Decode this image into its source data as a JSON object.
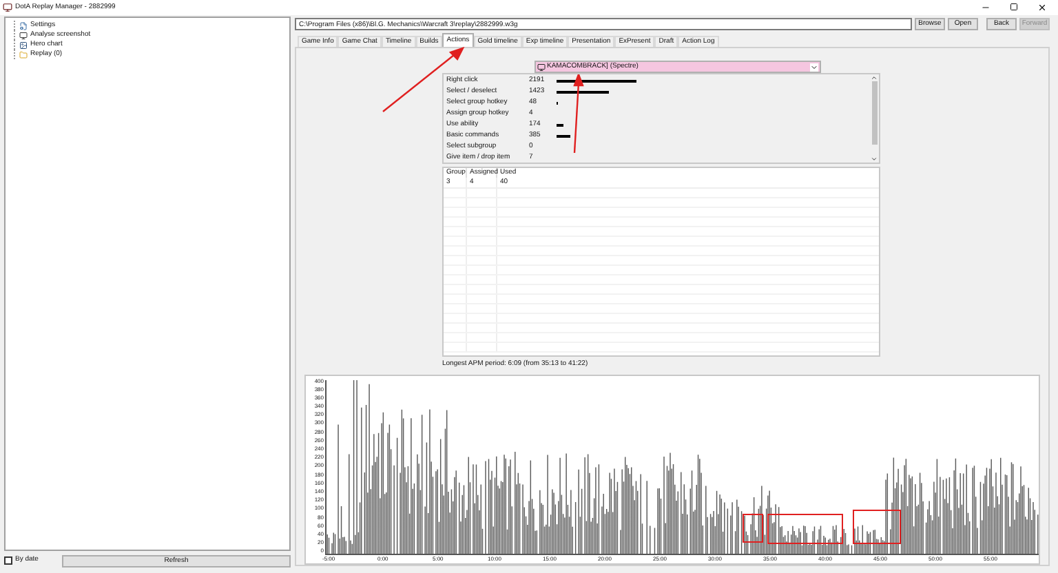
{
  "window": {
    "title": "DotA Replay Manager - 2882999"
  },
  "tree": [
    {
      "label": "Settings"
    },
    {
      "label": "Analyse screenshot"
    },
    {
      "label": "Hero chart"
    },
    {
      "label": "Replay (0)"
    }
  ],
  "by_date": {
    "label": "By date",
    "checked": false
  },
  "refresh_button": "Refresh",
  "path_field": {
    "value": "C:\\Program Files (x86)\\Bl.G. Mechanics\\Warcraft 3\\replay\\2882999.w3g"
  },
  "nav_buttons": [
    {
      "label": "Browse",
      "disabled": false
    },
    {
      "label": "Open",
      "disabled": false
    },
    {
      "label": "Back",
      "disabled": false
    },
    {
      "label": "Forward",
      "disabled": true
    }
  ],
  "tabs": [
    {
      "label": "Game Info",
      "selected": false
    },
    {
      "label": "Game Chat",
      "selected": false
    },
    {
      "label": "Timeline",
      "selected": false
    },
    {
      "label": "Builds",
      "selected": false
    },
    {
      "label": "Actions",
      "selected": true
    },
    {
      "label": "Gold timeline",
      "selected": false
    },
    {
      "label": "Exp timeline",
      "selected": false
    },
    {
      "label": "Presentation",
      "selected": false
    },
    {
      "label": "ExPresent",
      "selected": false
    },
    {
      "label": "Draft",
      "selected": false
    },
    {
      "label": "Action Log",
      "selected": false
    }
  ],
  "player_select": {
    "value": "KAMACOMBRACK] (Spectre)"
  },
  "actions": [
    {
      "name": "Right click",
      "count": "2191"
    },
    {
      "name": "Select / deselect",
      "count": "1423"
    },
    {
      "name": "Select group hotkey",
      "count": "48"
    },
    {
      "name": "Assign group hotkey",
      "count": "4"
    },
    {
      "name": "Use ability",
      "count": "174"
    },
    {
      "name": "Basic commands",
      "count": "385"
    },
    {
      "name": "Select subgroup",
      "count": "0"
    },
    {
      "name": "Give item / drop item",
      "count": "7"
    }
  ],
  "groups_table": {
    "columns": [
      "Group",
      "Assigned",
      "Used"
    ],
    "rows": [
      [
        "3",
        "4",
        "40"
      ]
    ]
  },
  "longest_apm": "Longest APM period: 6:09 (from 35:13 to 41:22)",
  "chart": {
    "y_ticks": [
      "400",
      "380",
      "360",
      "340",
      "320",
      "300",
      "280",
      "260",
      "240",
      "220",
      "200",
      "180",
      "160",
      "140",
      "120",
      "100",
      "80",
      "60",
      "40",
      "20",
      "0"
    ],
    "x_ticks": [
      "-5:00",
      "0:00",
      "5:00",
      "10:00",
      "15:00",
      "20:00",
      "25:00",
      "30:00",
      "35:00",
      "40:00",
      "45:00",
      "50:00",
      "55:00"
    ]
  }
}
